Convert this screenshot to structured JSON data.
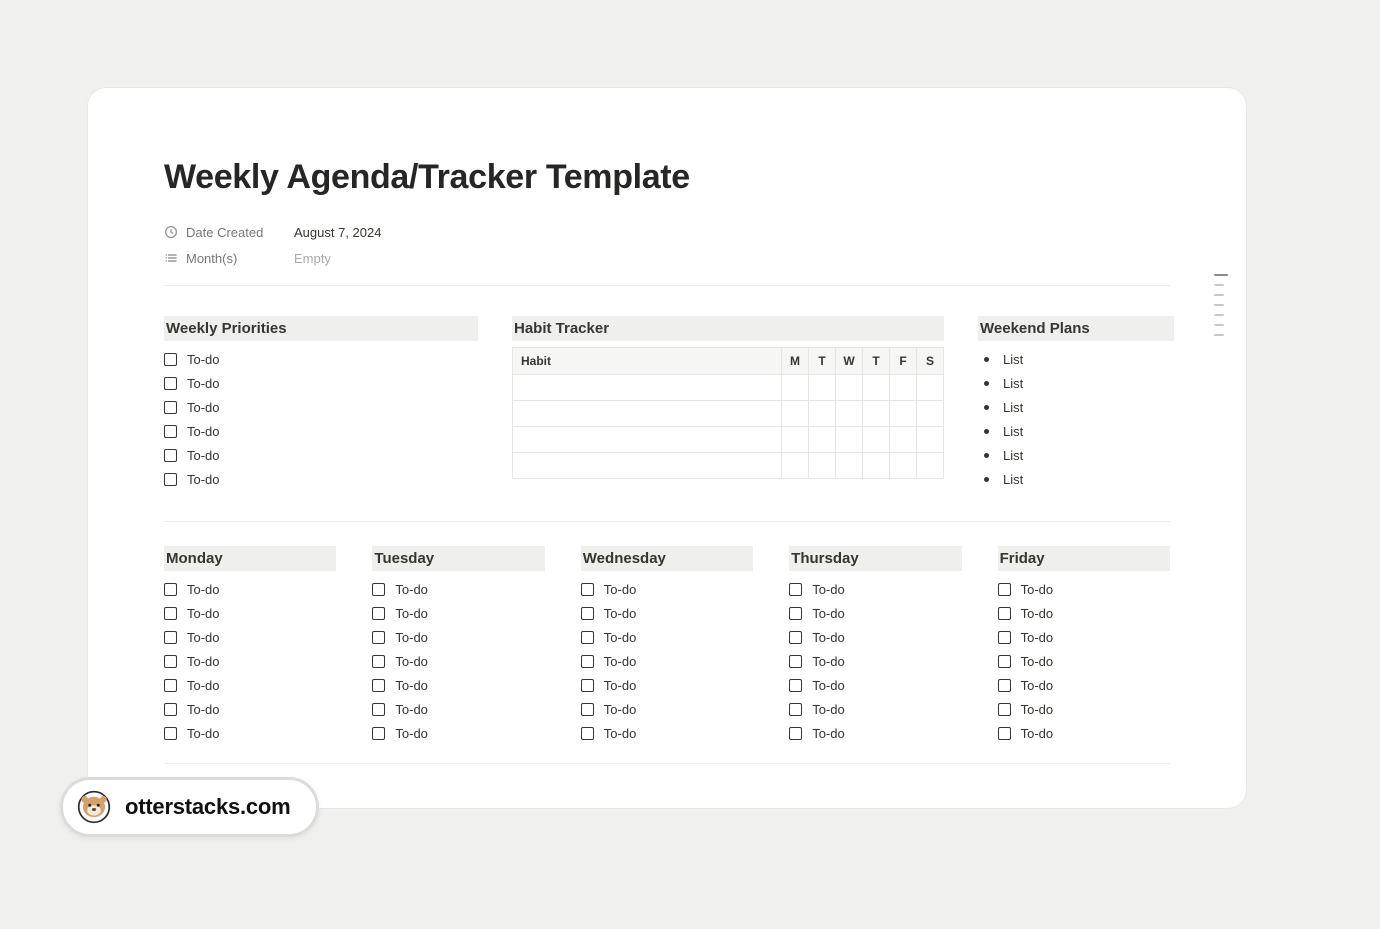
{
  "page": {
    "title": "Weekly Agenda/Tracker Template",
    "properties": {
      "date_created": {
        "label": "Date Created",
        "value": "August 7, 2024"
      },
      "months": {
        "label": "Month(s)",
        "value": "Empty",
        "empty": true
      }
    }
  },
  "sections": {
    "weekly_priorities": {
      "title": "Weekly Priorities",
      "items": [
        "To-do",
        "To-do",
        "To-do",
        "To-do",
        "To-do",
        "To-do"
      ]
    },
    "habit_tracker": {
      "title": "Habit Tracker",
      "habit_header": "Habit",
      "day_headers": [
        "M",
        "T",
        "W",
        "T",
        "F",
        "S"
      ],
      "rows": [
        "",
        "",
        "",
        ""
      ]
    },
    "weekend_plans": {
      "title": "Weekend Plans",
      "items": [
        "List",
        "List",
        "List",
        "List",
        "List",
        "List"
      ]
    }
  },
  "days": {
    "monday": {
      "title": "Monday",
      "items": [
        "To-do",
        "To-do",
        "To-do",
        "To-do",
        "To-do",
        "To-do",
        "To-do"
      ]
    },
    "tuesday": {
      "title": "Tuesday",
      "items": [
        "To-do",
        "To-do",
        "To-do",
        "To-do",
        "To-do",
        "To-do",
        "To-do"
      ]
    },
    "wednesday": {
      "title": "Wednesday",
      "items": [
        "To-do",
        "To-do",
        "To-do",
        "To-do",
        "To-do",
        "To-do",
        "To-do"
      ]
    },
    "thursday": {
      "title": "Thursday",
      "items": [
        "To-do",
        "To-do",
        "To-do",
        "To-do",
        "To-do",
        "To-do",
        "To-do"
      ]
    },
    "friday": {
      "title": "Friday",
      "items": [
        "To-do",
        "To-do",
        "To-do",
        "To-do",
        "To-do",
        "To-do",
        "To-do"
      ]
    }
  },
  "badge": {
    "text": "otterstacks.com"
  }
}
